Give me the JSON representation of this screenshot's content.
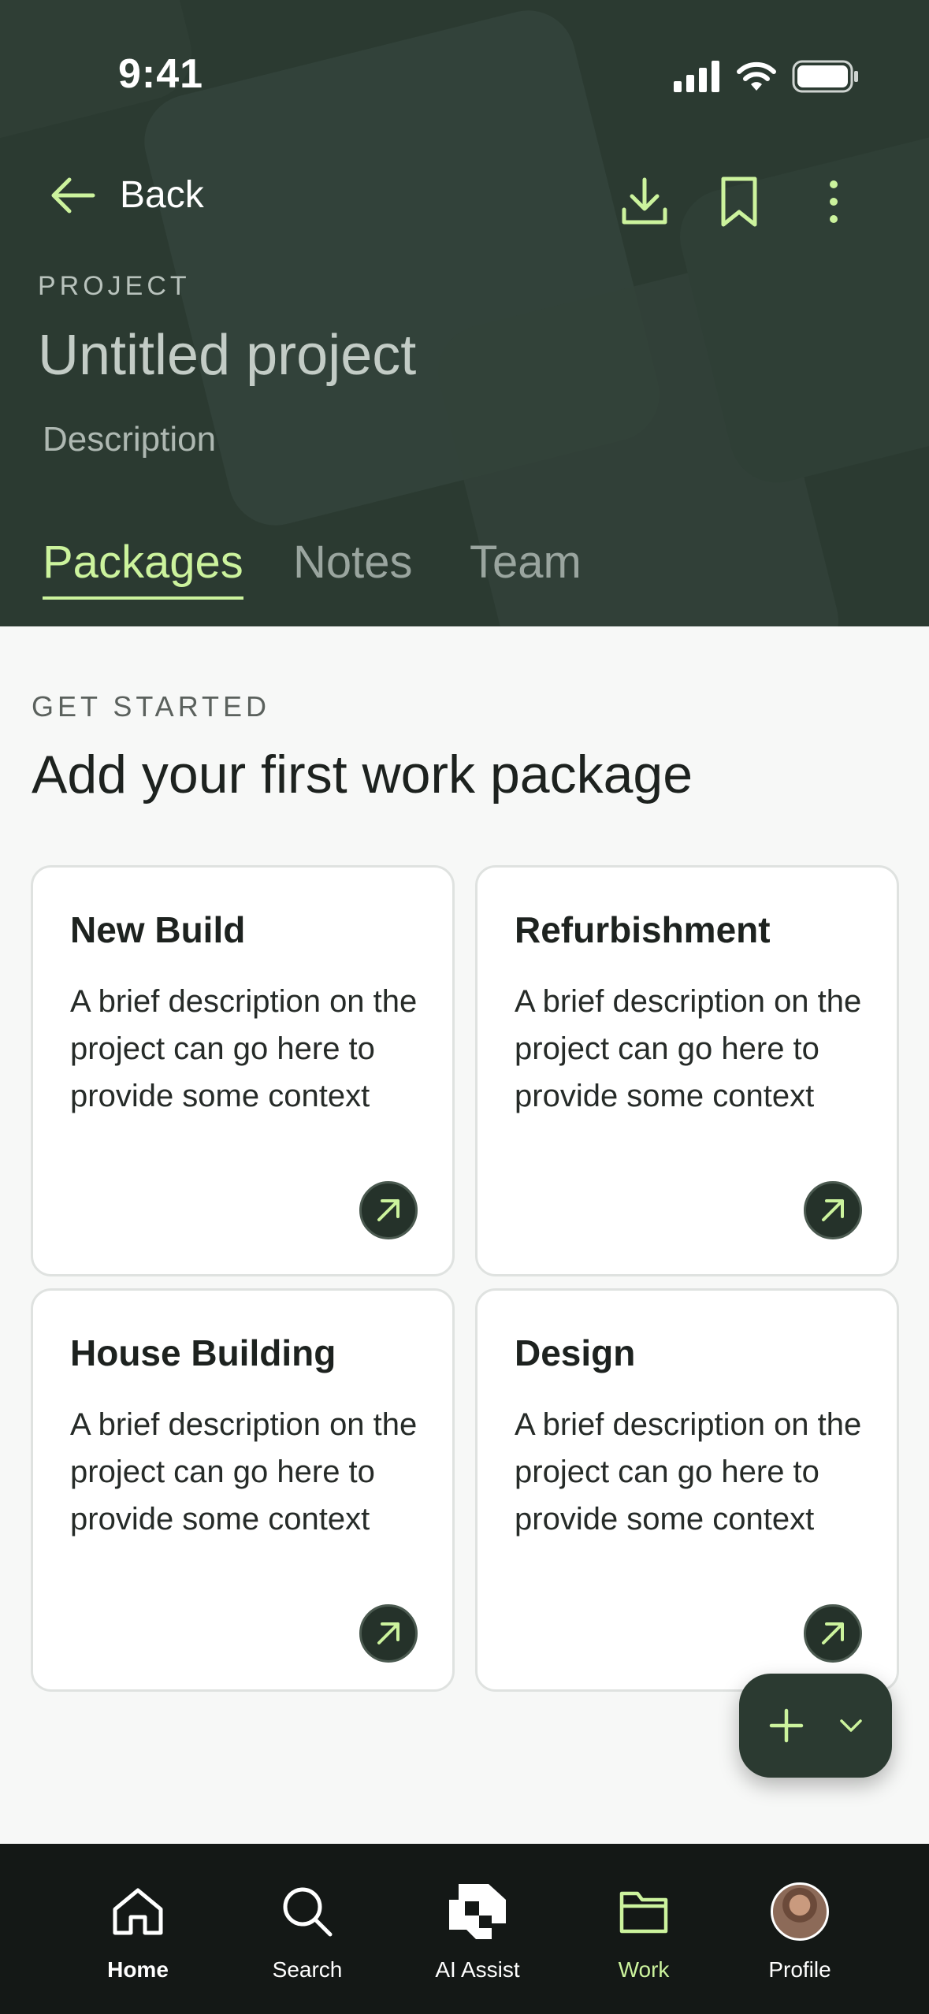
{
  "status_bar": {
    "time": "9:41"
  },
  "nav": {
    "back_label": "Back"
  },
  "project": {
    "label": "PROJECT",
    "title": "Untitled project",
    "description": "Description"
  },
  "tabs": [
    {
      "label": "Packages",
      "active": true
    },
    {
      "label": "Notes",
      "active": false
    },
    {
      "label": "Team",
      "active": false
    }
  ],
  "get_started": {
    "label": "GET STARTED",
    "title": "Add your first work package"
  },
  "cards": [
    {
      "title": "New Build",
      "description": "A brief description on the project can go here to provide some context"
    },
    {
      "title": "Refurbishment",
      "description": "A brief description on the project can go here to provide some context"
    },
    {
      "title": "House Building",
      "description": "A brief description on the project can go here to provide some context"
    },
    {
      "title": "Design",
      "description": "A brief description on the project can go here to provide some context"
    }
  ],
  "bottom_nav": [
    {
      "label": "Home",
      "icon": "home-icon"
    },
    {
      "label": "Search",
      "icon": "search-icon"
    },
    {
      "label": "AI Assist",
      "icon": "ai-assist-icon"
    },
    {
      "label": "Work",
      "icon": "folder-icon",
      "active": true
    },
    {
      "label": "Profile",
      "icon": "avatar"
    }
  ],
  "colors": {
    "header_bg": "#2b3a31",
    "accent": "#ccf39d",
    "nav_bg": "#141816",
    "page_bg": "#f7f8f7"
  }
}
